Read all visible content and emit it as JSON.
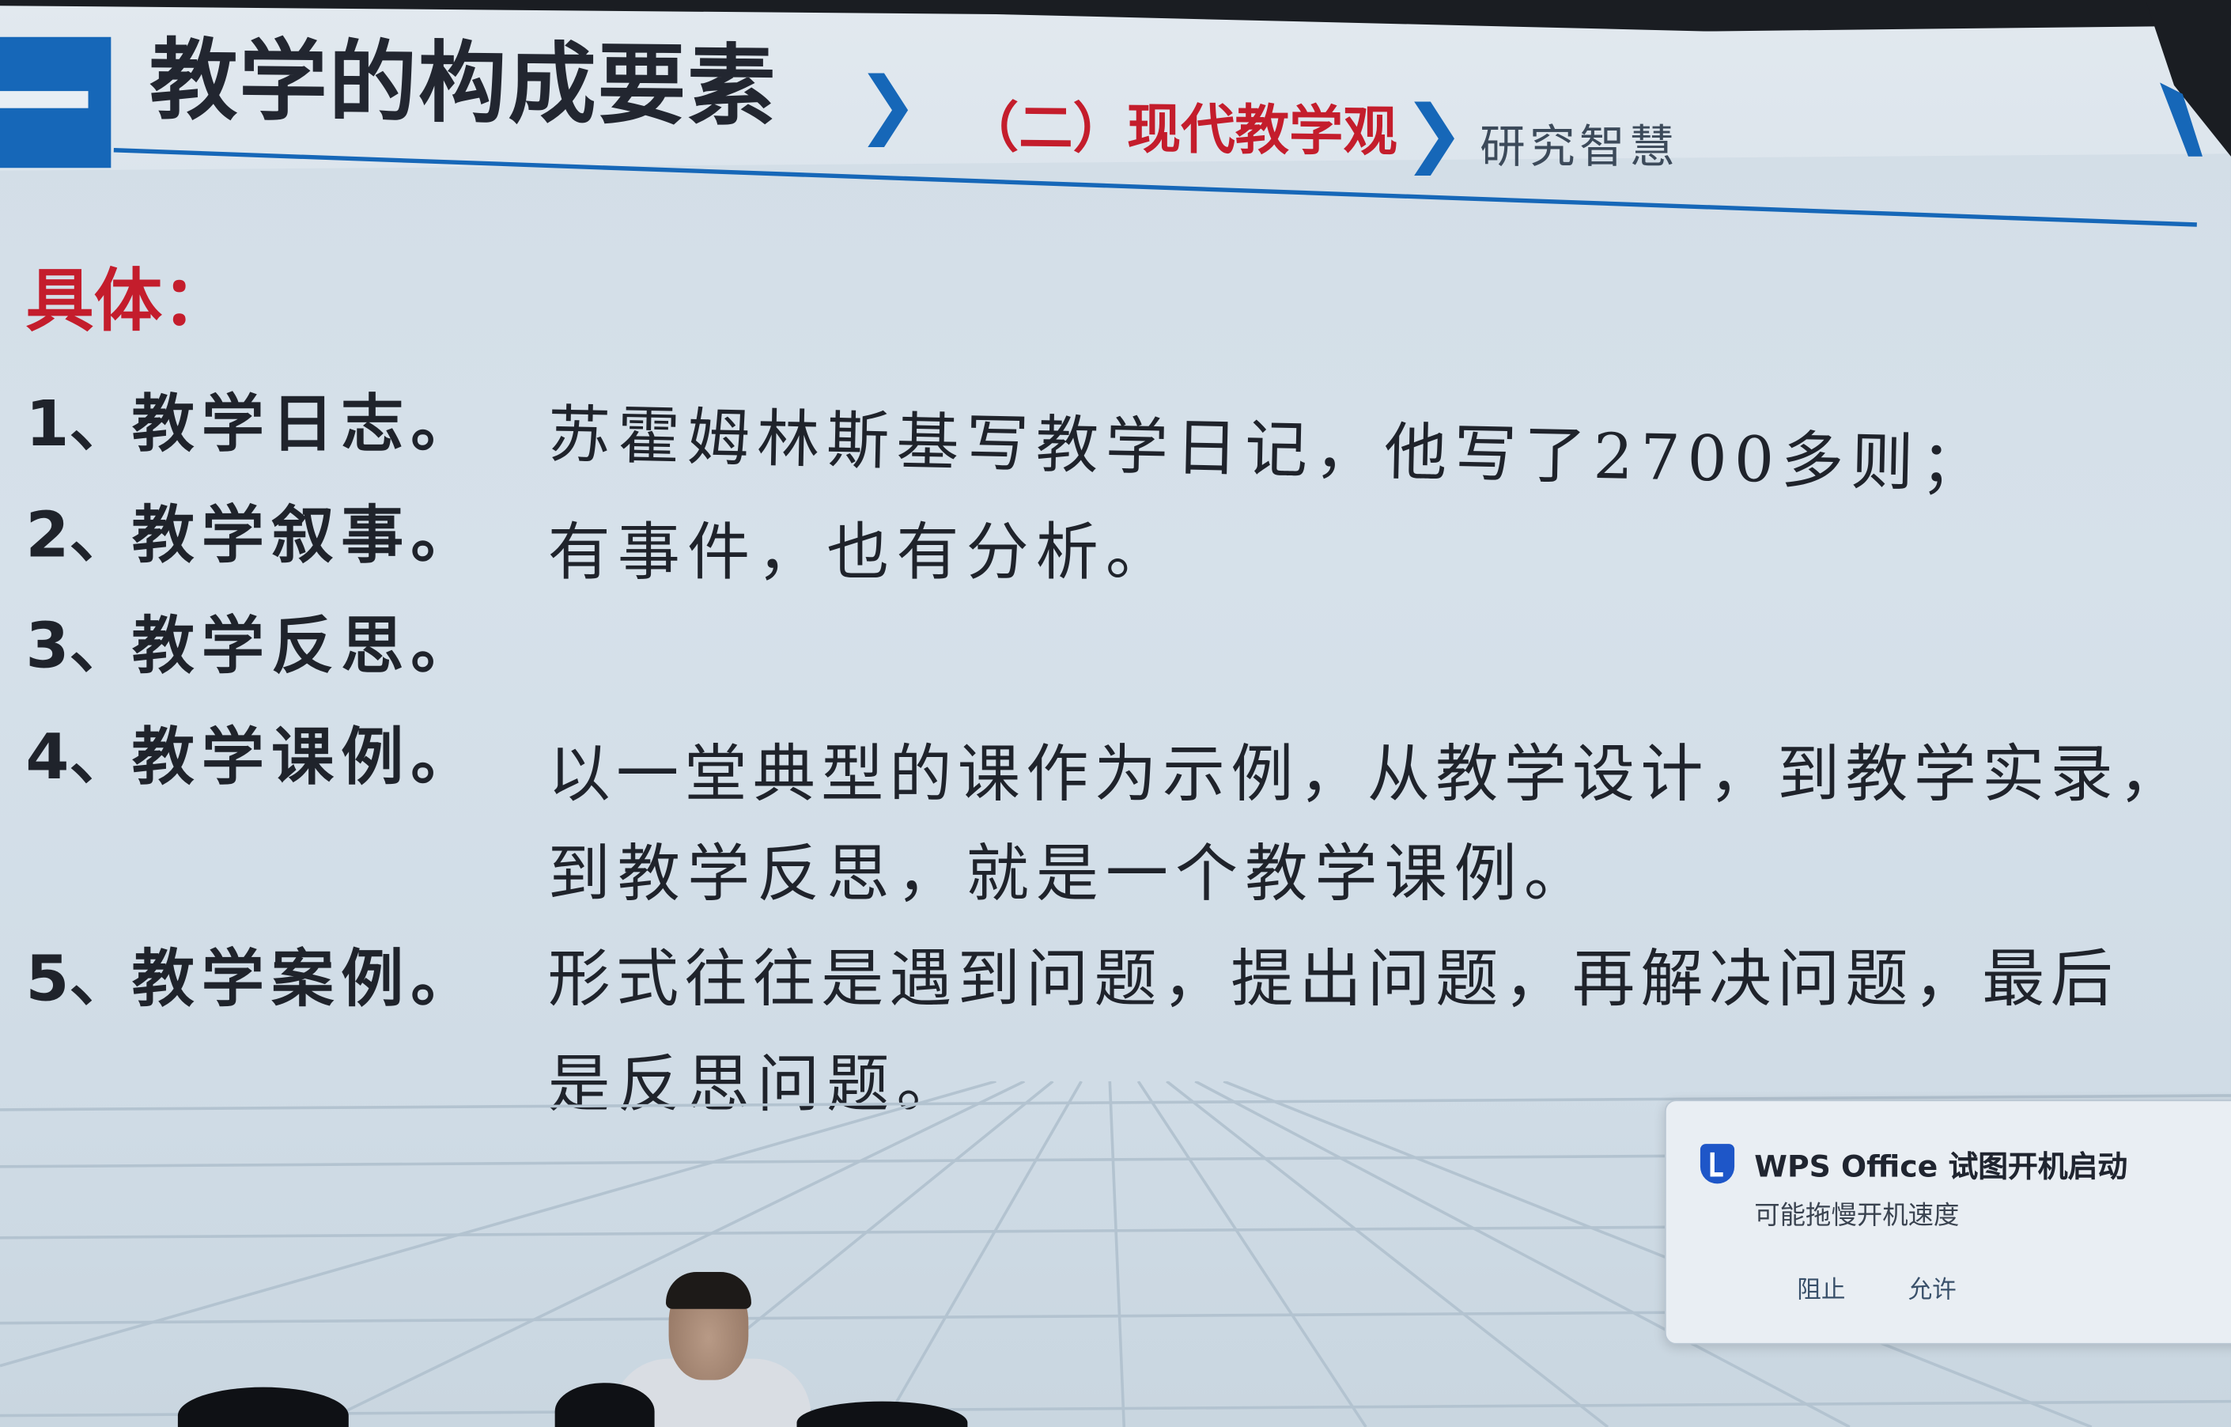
{
  "slide": {
    "title": "教学的构成要素",
    "breadcrumb": [
      "（二）现代教学观",
      "研究智慧"
    ],
    "subheading": "具体：",
    "items": [
      {
        "number": "1、",
        "label": "教学日志。",
        "lines": [
          "苏霍姆林斯基写教学日记，他写了2700多则；"
        ]
      },
      {
        "number": "2、",
        "label": "教学叙事。",
        "lines": [
          "有事件，也有分析。"
        ]
      },
      {
        "number": "3、",
        "label": "教学反思。",
        "lines": [
          ""
        ]
      },
      {
        "number": "4、",
        "label": "教学课例。",
        "lines": [
          "以一堂典型的课作为示例，从教学设计，到教学实录，",
          "到教学反思，就是一个教学课例。"
        ]
      },
      {
        "number": "5、",
        "label": "教学案例。",
        "lines": [
          "形式往往是遇到问题，提出问题，再解决问题，最后",
          "是反思问题。"
        ]
      }
    ]
  },
  "notification": {
    "title": "WPS Office 试图开机启动",
    "message": "可能拖慢开机速度",
    "block_label": "阻止",
    "allow_label": "允许",
    "icon": "shield-icon"
  },
  "colors": {
    "accent_blue": "#1667b8",
    "accent_red": "#c41d2c",
    "text_dark": "#1f232b"
  }
}
